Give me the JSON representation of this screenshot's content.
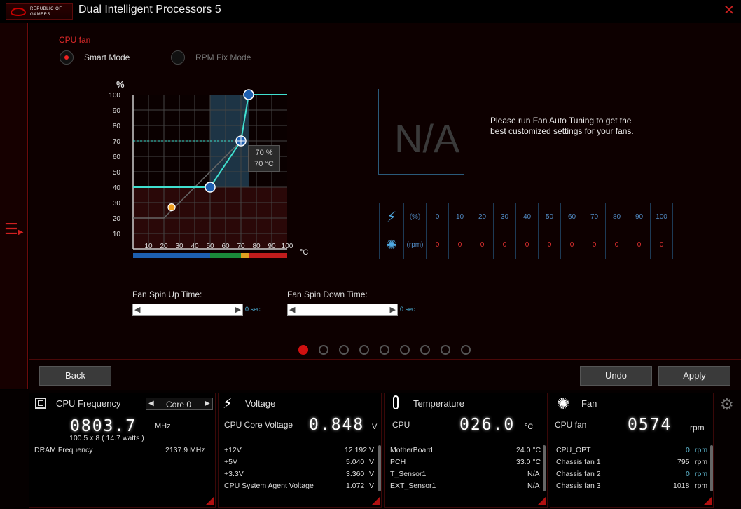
{
  "window": {
    "title": "Dual Intelligent Processors 5",
    "logo_line1": "REPUBLIC OF",
    "logo_line2": "GAMERS"
  },
  "fan": {
    "heading": "CPU fan",
    "mode_smart": "Smart Mode",
    "mode_rpm": "RPM Fix Mode"
  },
  "chart_data": {
    "type": "line",
    "ylabel": "%",
    "xlabel": "°C",
    "x_ticks": [
      "10",
      "20",
      "30",
      "40",
      "50",
      "60",
      "70",
      "80",
      "90",
      "100"
    ],
    "y_ticks": [
      "100",
      "90",
      "80",
      "70",
      "60",
      "50",
      "40",
      "30",
      "20",
      "10"
    ],
    "xlim": [
      0,
      100
    ],
    "ylim": [
      0,
      100
    ],
    "series": [
      {
        "points": [
          [
            0,
            40
          ],
          [
            50,
            40
          ],
          [
            70,
            70
          ],
          [
            75,
            100
          ],
          [
            100,
            100
          ]
        ],
        "color": "#40e0d0"
      },
      {
        "points": [
          [
            0,
            20
          ],
          [
            20,
            20
          ],
          [
            70,
            70
          ],
          [
            75,
            100
          ]
        ],
        "color": "#666666"
      }
    ],
    "control_points": [
      [
        50,
        40
      ],
      [
        70,
        70
      ],
      [
        75,
        100
      ]
    ],
    "orange_point": [
      25,
      27
    ],
    "tooltip": {
      "line1": "70 %",
      "line2": "70 °C"
    },
    "color_bands": [
      {
        "from": 0,
        "to": 50,
        "color": "#1d5fb0"
      },
      {
        "from": 50,
        "to": 70,
        "color": "#1a8a3a"
      },
      {
        "from": 70,
        "to": 75,
        "color": "#e0a020"
      },
      {
        "from": 75,
        "to": 100,
        "color": "#c01c1c"
      }
    ]
  },
  "spin": {
    "up_label": "Fan Spin Up Time:",
    "down_label": "Fan Spin Down Time:",
    "up_value": "0 sec",
    "down_value": "0 sec"
  },
  "tuning": {
    "na": "N/A",
    "message": "Please run Fan Auto Tuning to get the best customized settings for your fans."
  },
  "rpm_table": {
    "pct_unit": "(%)",
    "rpm_unit": "(rpm)",
    "pct": [
      "0",
      "10",
      "20",
      "30",
      "40",
      "50",
      "60",
      "70",
      "80",
      "90",
      "100"
    ],
    "rpm": [
      "0",
      "0",
      "0",
      "0",
      "0",
      "0",
      "0",
      "0",
      "0",
      "0",
      "0"
    ]
  },
  "nav": {
    "back": "Back",
    "undo": "Undo",
    "apply": "Apply"
  },
  "cpu": {
    "title": "CPU Frequency",
    "core": "Core 0",
    "freq": "0803.7",
    "freq_unit": "MHz",
    "detail": "100.5  x 8  ( 14.7   watts )",
    "dram_label": "DRAM Frequency",
    "dram_value": "2137.9  MHz"
  },
  "voltage": {
    "title": "Voltage",
    "core_label": "CPU Core Voltage",
    "core_value": "0.848",
    "core_unit": "V",
    "rows": [
      {
        "n": "+12V",
        "v": "12.192",
        "u": "V"
      },
      {
        "n": "+5V",
        "v": "5.040",
        "u": "V"
      },
      {
        "n": "+3.3V",
        "v": "3.360",
        "u": "V"
      },
      {
        "n": "CPU System Agent Voltage",
        "v": "1.072",
        "u": "V"
      }
    ]
  },
  "temp": {
    "title": "Temperature",
    "cpu_label": "CPU",
    "cpu_value": "026.0",
    "cpu_unit": "°C",
    "rows": [
      {
        "n": "MotherBoard",
        "v": "24.0 °C"
      },
      {
        "n": "PCH",
        "v": "33.0 °C"
      },
      {
        "n": "T_Sensor1",
        "v": "N/A"
      },
      {
        "n": "EXT_Sensor1",
        "v": "N/A"
      }
    ]
  },
  "fans": {
    "title": "Fan",
    "cpu_label": "CPU fan",
    "cpu_value": "0574",
    "cpu_unit": "rpm",
    "rows": [
      {
        "n": "CPU_OPT",
        "v": "0",
        "u": "rpm"
      },
      {
        "n": "Chassis fan 1",
        "v": "795",
        "u": "rpm"
      },
      {
        "n": "Chassis fan 2",
        "v": "0",
        "u": "rpm"
      },
      {
        "n": "Chassis fan 3",
        "v": "1018",
        "u": "rpm"
      }
    ]
  }
}
